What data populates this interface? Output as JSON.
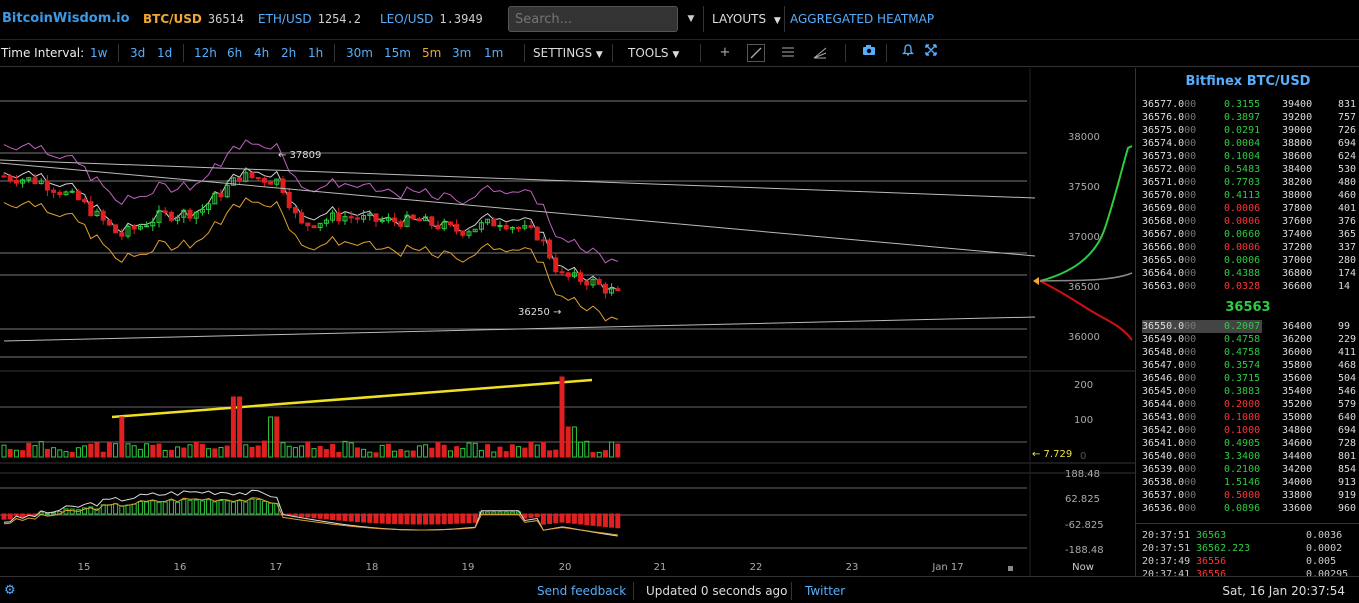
{
  "header": {
    "logo": "BitcoinWisdom.io",
    "tickers": [
      {
        "symbol": "BTC/USD",
        "value": "36514"
      },
      {
        "symbol": "ETH/USD",
        "value": "1254.2"
      },
      {
        "symbol": "LEO/USD",
        "value": "1.3949"
      }
    ],
    "search_placeholder": "Search...",
    "layouts_label": "LAYOUTS",
    "heatmap_label": "AGGREGATED HEATMAP"
  },
  "toolbar": {
    "time_interval_label": "Time Interval:",
    "intervals": [
      "1w",
      "3d",
      "1d",
      "12h",
      "6h",
      "4h",
      "2h",
      "1h",
      "30m",
      "15m",
      "5m",
      "3m",
      "1m"
    ],
    "active_interval": "5m",
    "settings_label": "SETTINGS",
    "tools_label": "TOOLS"
  },
  "chart": {
    "price_ticks": [
      "38000",
      "37500",
      "37000",
      "36500",
      "36000"
    ],
    "volume_ticks": [
      "200",
      "100"
    ],
    "volume_zero": "0",
    "volume_value": "7.729",
    "macd_ticks": [
      "188.48",
      "62.825",
      "-62.825",
      "-188.48"
    ],
    "x_ticks": [
      "15",
      "16",
      "17",
      "18",
      "19",
      "20",
      "21",
      "22",
      "23",
      "Jan 17"
    ],
    "now_label": "Now",
    "high_annotation": "37809",
    "low_annotation": "36250",
    "colors": {
      "up": "#2ecc40",
      "down": "#e02020",
      "accent": "#f0a830",
      "link": "#57aefc"
    }
  },
  "orderbook": {
    "title": "Bitfinex BTC/USD",
    "asks": [
      {
        "price": "36577.0",
        "dec": "00",
        "amount": "0.3155",
        "sum": "39400",
        "total": "831"
      },
      {
        "price": "36576.0",
        "dec": "00",
        "amount": "0.3897",
        "sum": "39200",
        "total": "757"
      },
      {
        "price": "36575.0",
        "dec": "00",
        "amount": "0.0291",
        "sum": "39000",
        "total": "726"
      },
      {
        "price": "36574.0",
        "dec": "00",
        "amount": "0.0004",
        "sum": "38800",
        "total": "694"
      },
      {
        "price": "36573.0",
        "dec": "00",
        "amount": "0.1004",
        "sum": "38600",
        "total": "624"
      },
      {
        "price": "36572.0",
        "dec": "00",
        "amount": "0.5483",
        "sum": "38400",
        "total": "530"
      },
      {
        "price": "36571.0",
        "dec": "00",
        "amount": "0.7703",
        "sum": "38200",
        "total": "480"
      },
      {
        "price": "36570.0",
        "dec": "00",
        "amount": "0.4113",
        "sum": "38000",
        "total": "460"
      },
      {
        "price": "36569.0",
        "dec": "00",
        "amount": "0.0006",
        "sum": "37800",
        "total": "401"
      },
      {
        "price": "36568.0",
        "dec": "00",
        "amount": "0.0006",
        "sum": "37600",
        "total": "376"
      },
      {
        "price": "36567.0",
        "dec": "00",
        "amount": "0.0660",
        "sum": "37400",
        "total": "365"
      },
      {
        "price": "36566.0",
        "dec": "00",
        "amount": "0.0006",
        "sum": "37200",
        "total": "337"
      },
      {
        "price": "36565.0",
        "dec": "00",
        "amount": "0.0006",
        "sum": "37000",
        "total": "280"
      },
      {
        "price": "36564.0",
        "dec": "00",
        "amount": "0.4388",
        "sum": "36800",
        "total": "174"
      },
      {
        "price": "36563.0",
        "dec": "00",
        "amount": "0.0328",
        "sum": "36600",
        "total": "14"
      }
    ],
    "ask_colors": [
      "g",
      "g",
      "g",
      "g",
      "g",
      "g",
      "g",
      "g",
      "r",
      "r",
      "g",
      "r",
      "g",
      "g",
      "r"
    ],
    "mid": "36563",
    "bids": [
      {
        "price": "36550.0",
        "dec": "00",
        "amount": "0.2007",
        "sum": "36400",
        "total": "99"
      },
      {
        "price": "36549.0",
        "dec": "00",
        "amount": "0.4758",
        "sum": "36200",
        "total": "229"
      },
      {
        "price": "36548.0",
        "dec": "00",
        "amount": "0.4758",
        "sum": "36000",
        "total": "411"
      },
      {
        "price": "36547.0",
        "dec": "00",
        "amount": "0.3574",
        "sum": "35800",
        "total": "468"
      },
      {
        "price": "36546.0",
        "dec": "00",
        "amount": "0.3715",
        "sum": "35600",
        "total": "504"
      },
      {
        "price": "36545.0",
        "dec": "00",
        "amount": "0.3883",
        "sum": "35400",
        "total": "546"
      },
      {
        "price": "36544.0",
        "dec": "00",
        "amount": "0.2000",
        "sum": "35200",
        "total": "579"
      },
      {
        "price": "36543.0",
        "dec": "00",
        "amount": "0.1000",
        "sum": "35000",
        "total": "640"
      },
      {
        "price": "36542.0",
        "dec": "00",
        "amount": "0.1000",
        "sum": "34800",
        "total": "694"
      },
      {
        "price": "36541.0",
        "dec": "00",
        "amount": "0.4905",
        "sum": "34600",
        "total": "728"
      },
      {
        "price": "36540.0",
        "dec": "00",
        "amount": "3.3400",
        "sum": "34400",
        "total": "801"
      },
      {
        "price": "36539.0",
        "dec": "00",
        "amount": "0.2100",
        "sum": "34200",
        "total": "854"
      },
      {
        "price": "36538.0",
        "dec": "00",
        "amount": "1.5146",
        "sum": "34000",
        "total": "913"
      },
      {
        "price": "36537.0",
        "dec": "00",
        "amount": "0.5000",
        "sum": "33800",
        "total": "919"
      },
      {
        "price": "36536.0",
        "dec": "00",
        "amount": "0.0896",
        "sum": "33600",
        "total": "960"
      }
    ],
    "bid_colors": [
      "g",
      "g",
      "g",
      "g",
      "g",
      "g",
      "r",
      "r",
      "r",
      "g",
      "g",
      "g",
      "g",
      "r",
      "g"
    ]
  },
  "trades": [
    {
      "time": "20:37:51",
      "price": "36563",
      "amount": "0.0036",
      "side": "g"
    },
    {
      "time": "20:37:51",
      "price": "36562.223",
      "amount": "0.0002",
      "side": "g"
    },
    {
      "time": "20:37:49",
      "price": "36556",
      "amount": "0.005",
      "side": "r"
    },
    {
      "time": "20:37:41",
      "price": "36556",
      "amount": "0.00295",
      "side": "r"
    }
  ],
  "status": {
    "feedback": "Send feedback",
    "updated": "Updated 0 seconds ago",
    "twitter": "Twitter",
    "datetime": "Sat, 16 Jan 20:37:54"
  }
}
